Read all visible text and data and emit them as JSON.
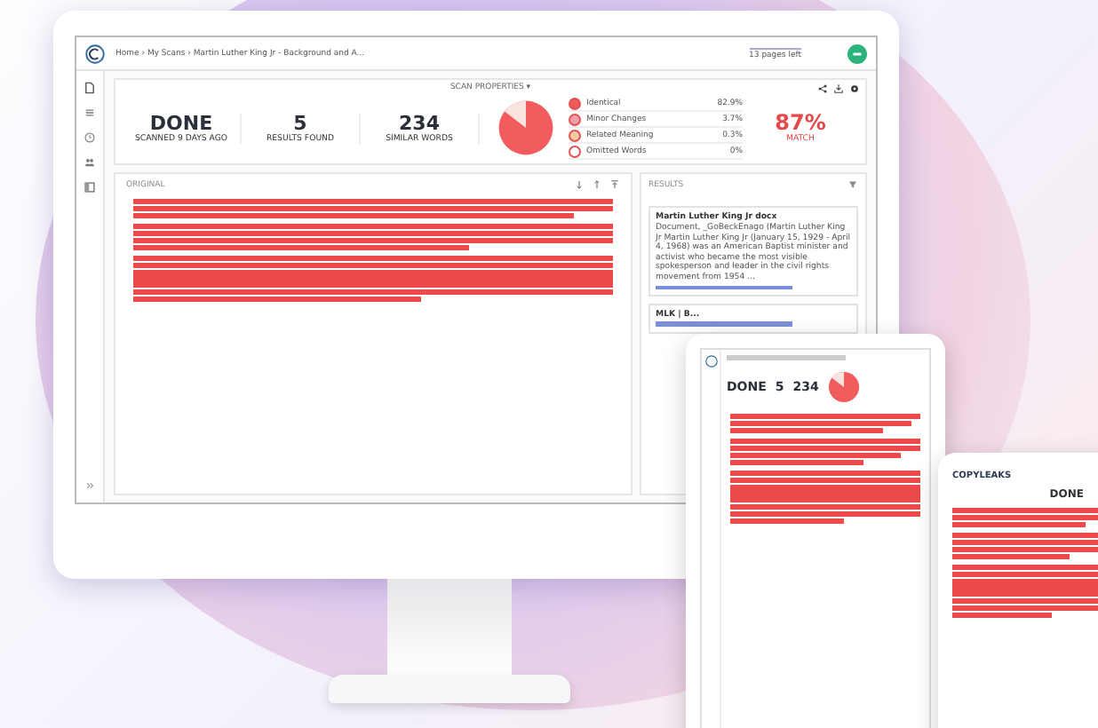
{
  "breadcrumb": "Home › My Scans › Martin Luther King Jr - Background and A...",
  "pages_left": "13 pages left",
  "scan_properties": "SCAN PROPERTIES ▾",
  "stats": [
    {
      "value": "DONE",
      "label": "SCANNED 9 DAYS AGO"
    },
    {
      "value": "5",
      "label": "RESULTS FOUND"
    },
    {
      "value": "234",
      "label": "SIMILAR WORDS"
    }
  ],
  "legend": [
    {
      "label": "Identical",
      "value": "82.9%",
      "color": "#f05a5a"
    },
    {
      "label": "Minor Changes",
      "value": "3.7%",
      "color": "#f2a0a8"
    },
    {
      "label": "Related Meaning",
      "value": "0.3%",
      "color": "#f7c9a0"
    },
    {
      "label": "Omitted Words",
      "value": "0%",
      "color": "#ffffff"
    }
  ],
  "match": {
    "value": "87%",
    "label": "MATCH"
  },
  "original_title": "ORIGINAL",
  "results": {
    "title": "RESULTS",
    "items": [
      {
        "title": "Martin Luther King Jr docx",
        "snippet": "Document, _GoBeckEnago (Martin Luther King Jr Martin Luther King Jr (January 15, 1929 - April 4, 1968) was an American Baptist minister and activist who became the most visible spokesperson and leader in the civil rights movement from 1954 ..."
      },
      {
        "title": "MLK | B..."
      }
    ]
  },
  "tablet": {
    "stats": [
      "DONE",
      "5",
      "234"
    ]
  },
  "phone": {
    "brand": "COPYLEAKS",
    "stat": "DONE"
  }
}
